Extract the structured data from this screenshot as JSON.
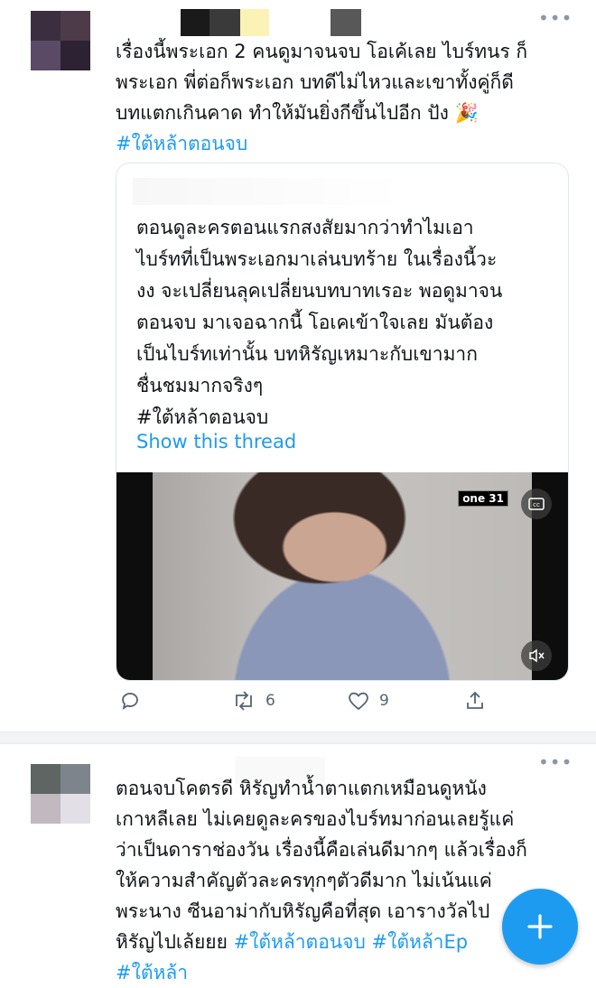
{
  "tweet1": {
    "text_lines": [
      "เรื่องนี้พระเอก 2 คนดูมาจนจบ โอเค้เลย ไบร์ทนร ก็",
      "พระเอก พี่ต่อก็พระเอก บทดีไม่ไหวและเขาทั้งคู่ก็ดี",
      "บทแตกเกินคาด ทำให้มันยิ่งกีขึ้นไปอีก ปัง 🎉"
    ],
    "hashtag": "#ใต้หล้าตอนจบ",
    "quote": {
      "lines": [
        "ตอนดูละครตอนแรกสงสัยมากว่าทำไมเอา",
        "ไบร์ทที่เป็นพระเอกมาเล่นบทร้าย ในเรื่องนี้วะ",
        "งง จะเปลี่ยนลุคเปลี่ยนบทบาทเรอะ พอดูมาจน",
        "ตอนจบ มาเจอฉากนี้ โอเคเข้าใจเลย มันต้อง",
        "เป็นไบร์ทเท่านั้น บทหิรัญเหมาะกับเขามาก",
        "ชื่นชมมากจริงๆ",
        "#ใต้หล้าตอนจบ"
      ],
      "show_thread": "Show this thread",
      "video_logo": "one 31"
    },
    "retweet_count": "6",
    "like_count": "9"
  },
  "tweet2": {
    "text_lines": [
      "ตอนจบโคตรดี หิรัญทำน้ำตาแตกเหมือนดูหนัง",
      "เกาหลีเลย ไม่เคยดูละครของไบร์ทมาก่อนเลยรู้แค่",
      "ว่าเป็นดาราช่องวัน เรื่องนี้คือเล่นดีมากๆ แล้วเรื่องก็",
      "ให้ความสำคัญตัวละครทุกๆตัวดีมาก ไม่เน้นแค่",
      "พระนาง ซีนอาม่ากับหิรัญคือที่สุด เอารางวัลไป"
    ],
    "last_line_text": "หิรัญไปเล้ยยย",
    "hashtag_a": "#ใต้หล้าตอนจบ",
    "hashtag_b": "#ใต้หล้าEp",
    "hashtag_c": "#ใต้หล้า"
  },
  "icons": {
    "more": "more-horizontal-icon",
    "reply": "reply-bubble-icon",
    "retweet": "retweet-icon",
    "like": "heart-icon",
    "share": "share-icon",
    "cc": "closed-caption-icon",
    "mute": "speaker-mute-icon",
    "compose": "plus-icon"
  },
  "colors": {
    "accent": "#1d9bf0",
    "text": "#0f1419",
    "muted": "#536471"
  }
}
